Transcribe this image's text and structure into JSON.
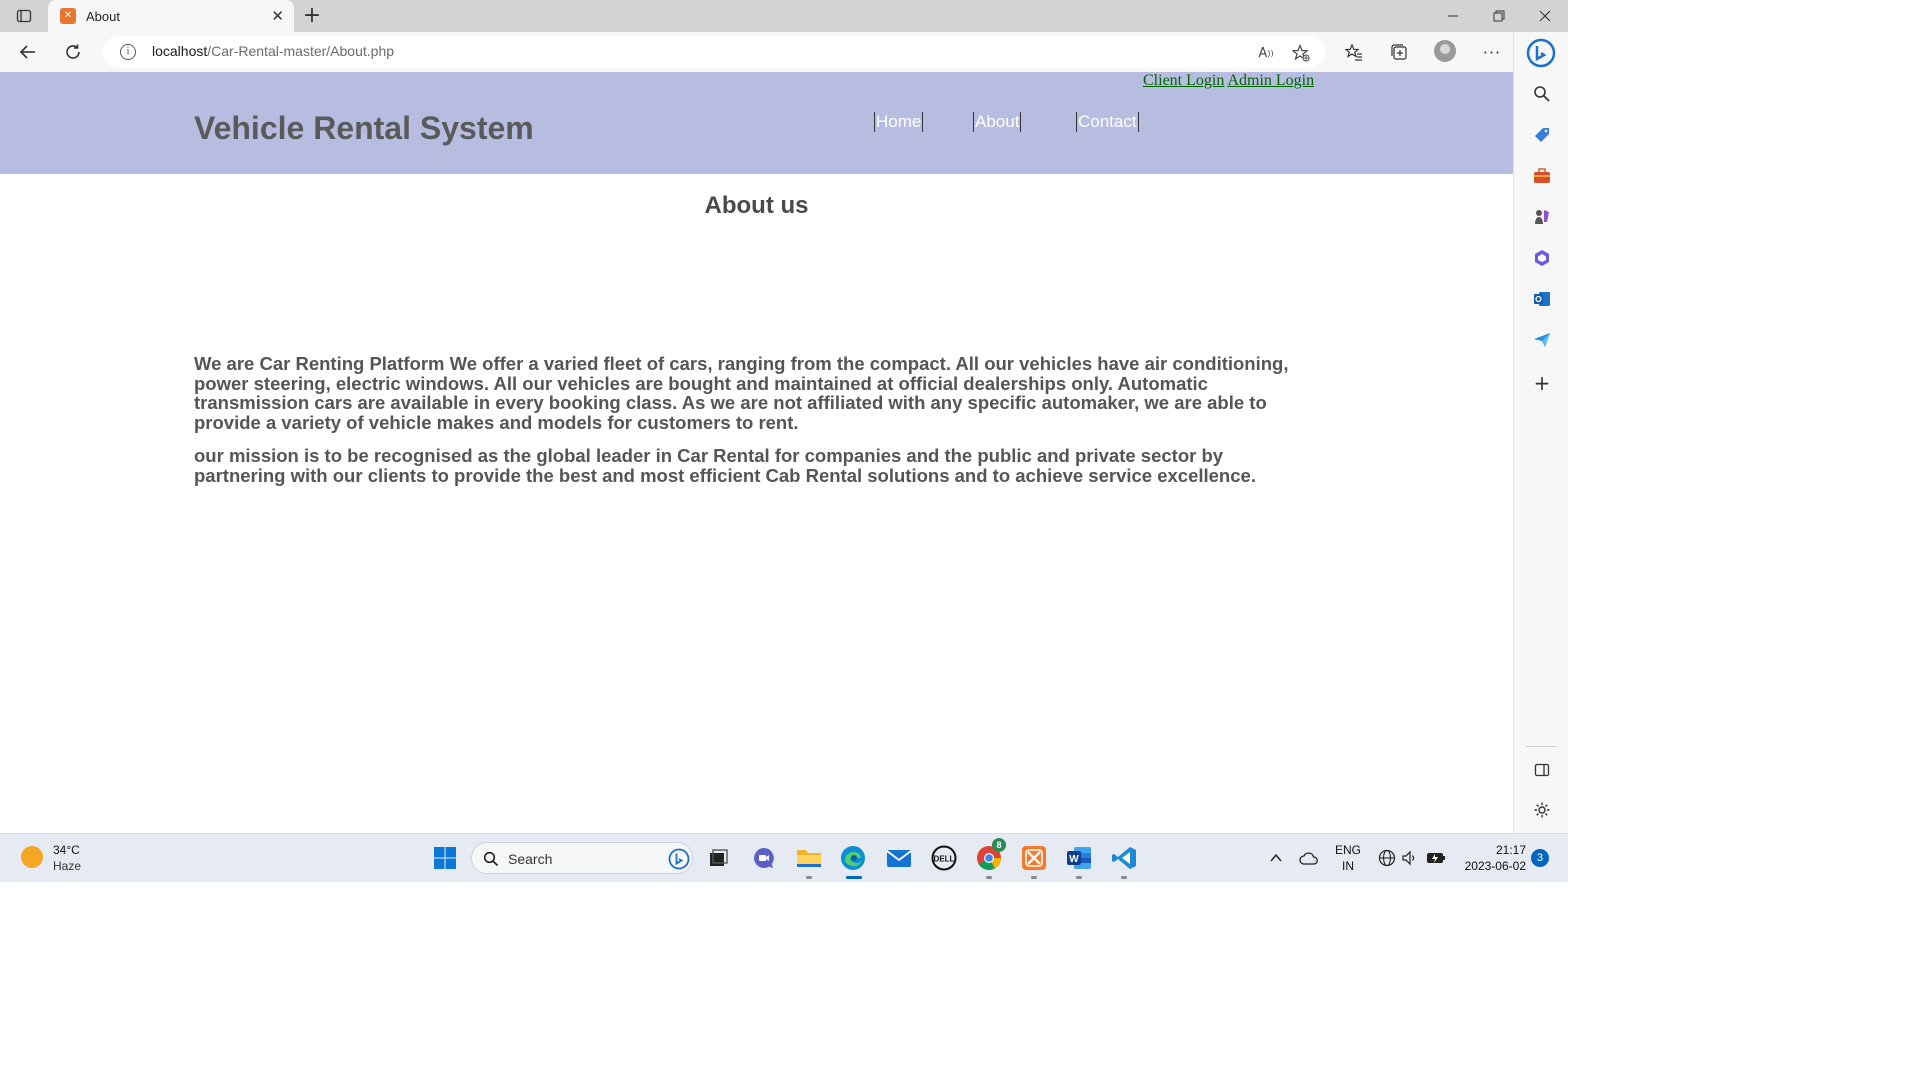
{
  "browser": {
    "tab": {
      "title": "About",
      "favicon": "xampp-icon"
    },
    "address": {
      "host": "localhost",
      "path": "/Car-Rental-master/About.php"
    }
  },
  "site": {
    "login_links": {
      "client": "Client Login",
      "admin": "Admin Login"
    },
    "title": "Vehicle Rental System",
    "nav": [
      {
        "label": "Home"
      },
      {
        "label": "About"
      },
      {
        "label": "Contact"
      }
    ],
    "colors": {
      "header_bg": "#b7bde0",
      "link": "#006400",
      "text": "#555555"
    }
  },
  "about": {
    "heading": "About us",
    "paragraphs": [
      "We are Car Renting Platform We offer a varied fleet of cars, ranging from the compact. All our vehicles have air conditioning, power steering, electric windows. All our vehicles are bought and maintained at official dealerships only. Automatic transmission cars are available in every booking class. As we are not affiliated with any specific automaker, we are able to provide a variety of vehicle makes and models for customers to rent.",
      "our mission is to be recognised as the global leader in Car Rental for companies and the public and private sector by partnering with our clients to provide the best and most efficient Cab Rental solutions and to achieve service excellence."
    ]
  },
  "taskbar": {
    "weather": {
      "temp": "34°C",
      "condition": "Haze"
    },
    "search_placeholder": "Search",
    "language": {
      "line1": "ENG",
      "line2": "IN"
    },
    "clock": {
      "time": "21:17",
      "date": "2023-06-02"
    },
    "notifications": "3",
    "chrome_badge": "8"
  }
}
